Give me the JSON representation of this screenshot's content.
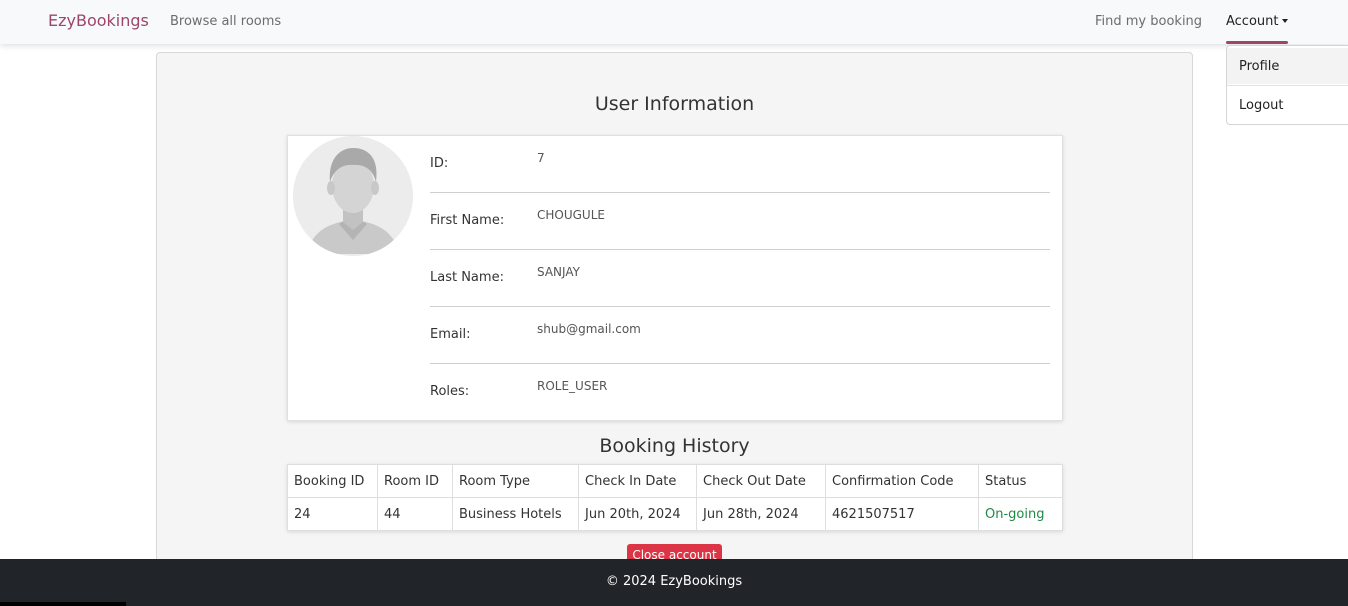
{
  "navbar": {
    "brand": "EzyBookings",
    "browse_label": "Browse all rooms",
    "find_label": "Find my booking",
    "account_label": "Account",
    "account_menu": [
      "Profile",
      "Logout"
    ]
  },
  "user_info": {
    "title": "User Information",
    "fields": [
      {
        "label": "ID:",
        "value": "7"
      },
      {
        "label": "First Name:",
        "value": "CHOUGULE"
      },
      {
        "label": "Last Name:",
        "value": "SANJAY"
      },
      {
        "label": "Email:",
        "value": "shub@gmail.com"
      },
      {
        "label": "Roles:",
        "value": "ROLE_USER"
      }
    ]
  },
  "booking_history": {
    "title": "Booking History",
    "columns": [
      "Booking ID",
      "Room ID",
      "Room Type",
      "Check In Date",
      "Check Out Date",
      "Confirmation Code",
      "Status"
    ],
    "rows": [
      [
        "24",
        "44",
        "Business Hotels",
        "Jun 20th, 2024",
        "Jun 28th, 2024",
        "4621507517",
        "On-going"
      ]
    ]
  },
  "close_account_label": "Close account",
  "footer": {
    "text": "© 2024 EzyBookings"
  },
  "colors": {
    "brand": "#9c4668",
    "danger": "#dc3545",
    "success": "#1e8a45",
    "footer_bg": "#212529"
  },
  "icons": {
    "avatar": "default-user-avatar-icon"
  }
}
